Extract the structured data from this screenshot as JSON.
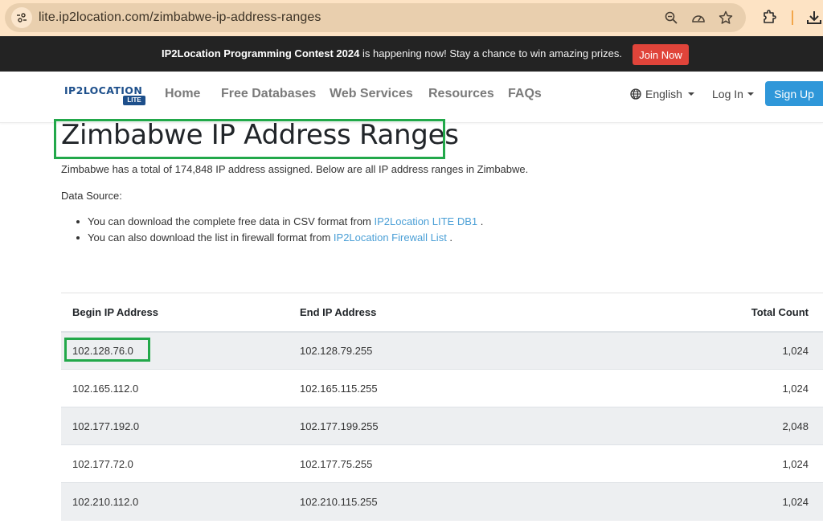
{
  "browser": {
    "url": "lite.ip2location.com/zimbabwe-ip-address-ranges",
    "icons": [
      "site-info-icon",
      "zoom-icon",
      "performance-icon",
      "bookmark-star-icon",
      "extensions-icon",
      "download-icon"
    ]
  },
  "announcement": {
    "bold": "IP2Location Programming Contest 2024",
    "text": " is happening now! Stay a chance to win amazing prizes.",
    "button": "Join Now"
  },
  "navbar": {
    "logo_text": "IP2LOCATION",
    "logo_badge": "LITE",
    "links": [
      "Home",
      "Free Databases",
      "Web Services",
      "Resources",
      "FAQs"
    ],
    "language": "English",
    "login": "Log In",
    "signup": "Sign Up"
  },
  "content": {
    "title": "Zimbabwe IP Address Ranges",
    "summary": "Zimbabwe has a total of 174,848 IP address assigned. Below are all IP address ranges in Zimbabwe.",
    "data_source_label": "Data Source:",
    "sources": [
      {
        "prefix": "You can download the complete free data in CSV format from ",
        "link": "IP2Location LITE DB1",
        "suffix": " ."
      },
      {
        "prefix": "You can also download the list in firewall format from ",
        "link": "IP2Location Firewall List",
        "suffix": " ."
      }
    ]
  },
  "table": {
    "headers": [
      "Begin IP Address",
      "End IP Address",
      "Total Count"
    ],
    "rows": [
      [
        "102.128.76.0",
        "102.128.79.255",
        "1,024"
      ],
      [
        "102.165.112.0",
        "102.165.115.255",
        "1,024"
      ],
      [
        "102.177.192.0",
        "102.177.199.255",
        "2,048"
      ],
      [
        "102.177.72.0",
        "102.177.75.255",
        "1,024"
      ],
      [
        "102.210.112.0",
        "102.210.115.255",
        "1,024"
      ]
    ]
  },
  "colors": {
    "highlight": "#22a84a",
    "accent": "#2f97d9",
    "join_button": "#e0443a",
    "link": "#4a9fd6"
  }
}
